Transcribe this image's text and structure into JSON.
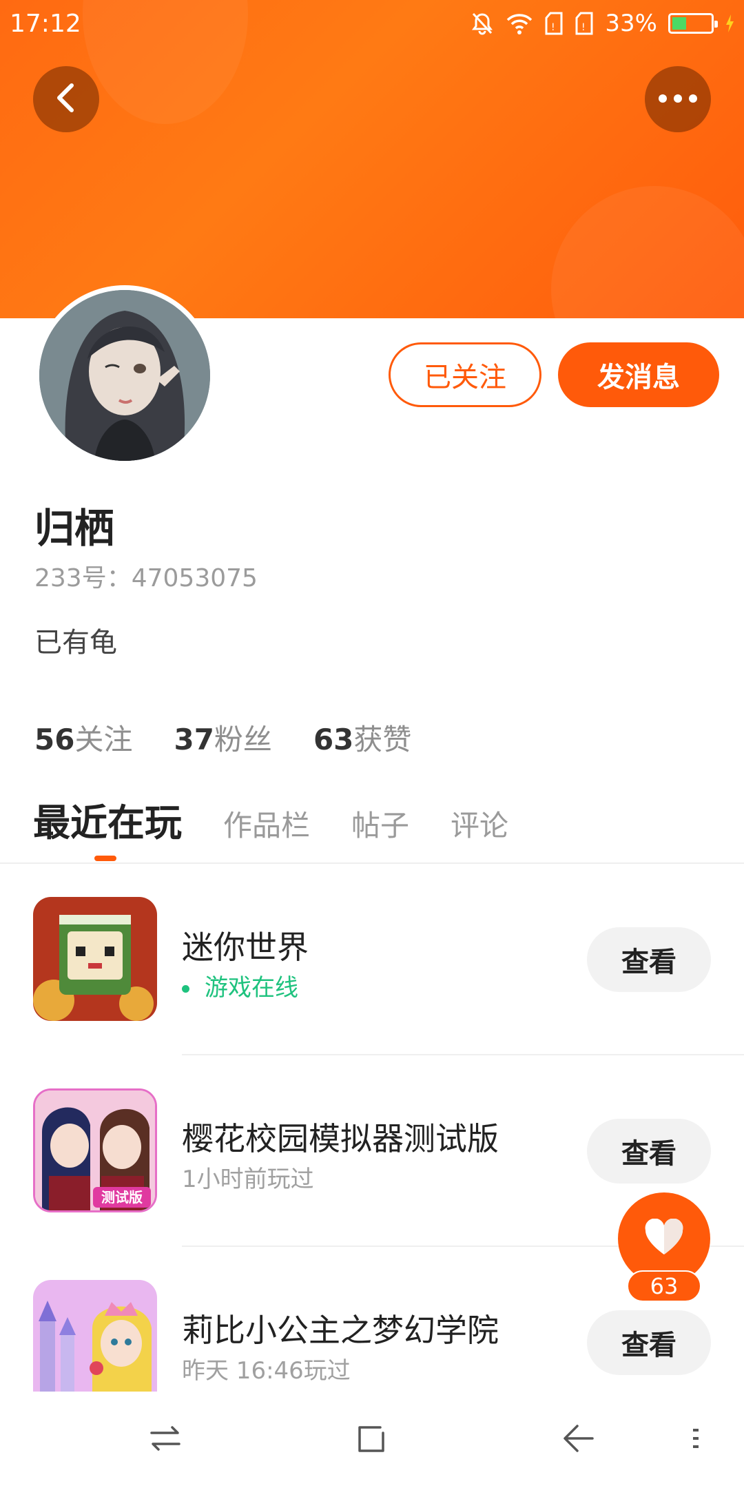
{
  "status_bar": {
    "time": "17:12",
    "battery": "33%",
    "battery_level": 0.33
  },
  "profile": {
    "name": "归栖",
    "id_label": "233号：",
    "id_value": "47053075",
    "bio": "已有龟",
    "follow_button": "已关注",
    "message_button": "发消息"
  },
  "stats": [
    {
      "num": "56",
      "label": "关注"
    },
    {
      "num": "37",
      "label": "粉丝"
    },
    {
      "num": "63",
      "label": "获赞"
    }
  ],
  "tabs": [
    {
      "label": "最近在玩",
      "active": true
    },
    {
      "label": "作品栏",
      "active": false
    },
    {
      "label": "帖子",
      "active": false
    },
    {
      "label": "评论",
      "active": false
    }
  ],
  "games": [
    {
      "title": "迷你世界",
      "subtitle": "游戏在线",
      "online": true,
      "button": "查看"
    },
    {
      "title": "樱花校园模拟器测试版",
      "subtitle": "1小时前玩过",
      "online": false,
      "button": "查看",
      "badge": "测试版"
    },
    {
      "title": "莉比小公主之梦幻学院",
      "subtitle": "昨天 16:46玩过",
      "online": false,
      "button": "查看"
    }
  ],
  "like": {
    "count": "63"
  },
  "icons": {
    "back": "back-arrow-icon",
    "more": "more-dots-icon",
    "heart": "heart-icon",
    "nav_recents": "switch-arrows-icon",
    "nav_home": "home-square-icon",
    "nav_back": "back-triangle-icon",
    "nav_menu": "menu-icon"
  },
  "colors": {
    "accent": "#ff5a0a",
    "online": "#1ec27e",
    "header": "#ff7a14"
  }
}
